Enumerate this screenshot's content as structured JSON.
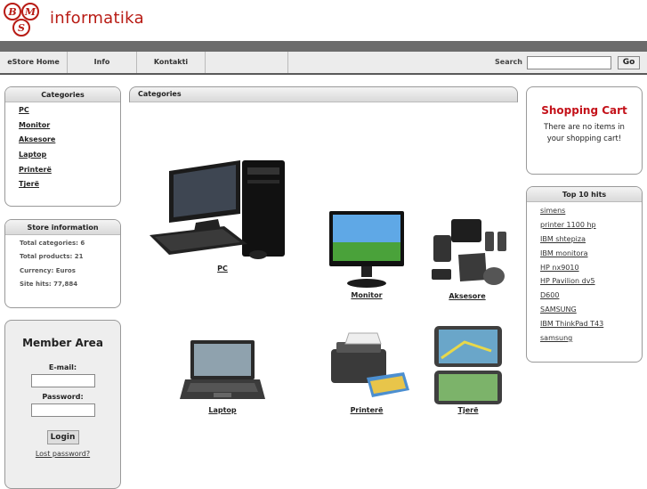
{
  "brand": {
    "name": "informatika",
    "logo_letters": [
      "B",
      "M",
      "S"
    ]
  },
  "nav": {
    "items": [
      "eStore Home",
      "Info",
      "Kontakti"
    ],
    "search_label": "Search",
    "go_label": "Go"
  },
  "categories_box": {
    "title": "Categories",
    "items": [
      "PC",
      "Monitor",
      "Aksesore",
      "Laptop",
      "Printerë",
      "Tjerë"
    ]
  },
  "store_info": {
    "title": "Store information",
    "lines": [
      "Total categories: 6",
      "Total products: 21",
      "Currency: Euros",
      "Site hits: 77,884"
    ]
  },
  "member": {
    "title": "Member Area",
    "email_label": "E-mail:",
    "password_label": "Password:",
    "login_label": "Login",
    "lost_password": "Lost password?"
  },
  "main": {
    "title": "Categories",
    "products": [
      "PC",
      "Monitor",
      "Aksesore",
      "Laptop",
      "Printerë",
      "Tjerë"
    ]
  },
  "cart": {
    "title": "Shopping Cart",
    "message": "There are no items in your shopping cart!"
  },
  "top_hits": {
    "title": "Top 10 hits",
    "items": [
      "simens",
      "printer 1100 hp",
      "IBM shtepiza",
      "IBM monitora",
      "HP nx9010",
      "HP Pavilion dv5",
      "D600",
      "SAMSUNG",
      "IBM ThinkPad T43",
      "samsung"
    ]
  },
  "colors": {
    "brand_red": "#b81b14",
    "cart_red": "#c4121a",
    "bar_gray": "#6b6b6b"
  }
}
